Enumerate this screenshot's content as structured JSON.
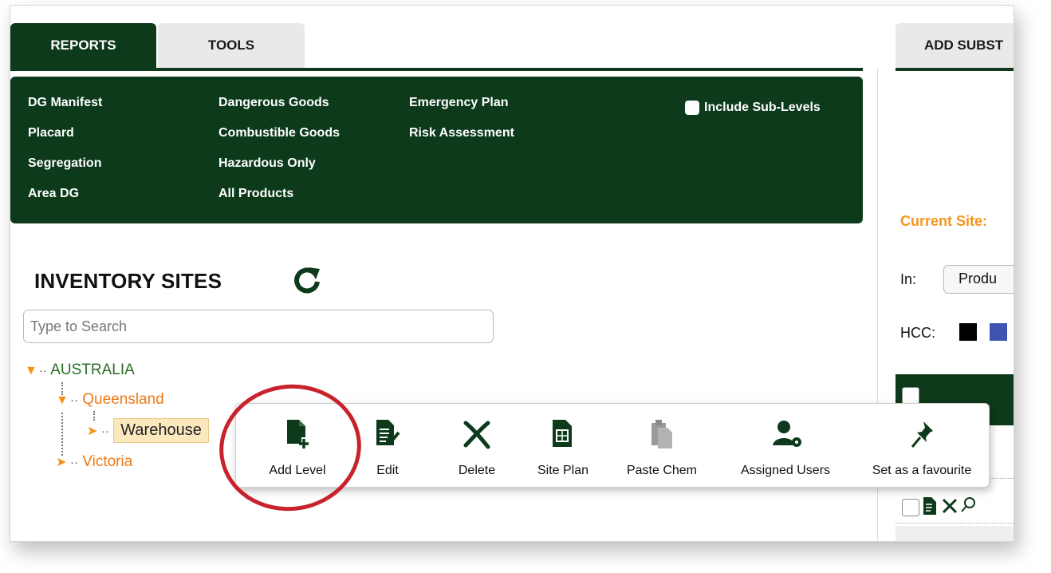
{
  "tabs": {
    "reports": "REPORTS",
    "tools": "TOOLS"
  },
  "reports": {
    "col1": [
      "DG Manifest",
      "Placard",
      "Segregation",
      "Area DG"
    ],
    "col2": [
      "Dangerous Goods",
      "Combustible Goods",
      "Hazardous Only",
      "All Products"
    ],
    "col3": [
      "Emergency Plan",
      "Risk Assessment"
    ],
    "include_sublevels_label": "Include Sub-Levels",
    "include_sublevels_checked": false
  },
  "inventory": {
    "title": "INVENTORY SITES",
    "search_placeholder": "Type to Search",
    "tree": {
      "root": "AUSTRALIA",
      "state1": "Queensland",
      "site": "Warehouse",
      "state2": "Victoria"
    }
  },
  "context_menu": {
    "items": [
      {
        "label": "Add Level",
        "icon": "add-level-icon"
      },
      {
        "label": "Edit",
        "icon": "edit-icon"
      },
      {
        "label": "Delete",
        "icon": "delete-icon"
      },
      {
        "label": "Site Plan",
        "icon": "site-plan-icon"
      },
      {
        "label": "Paste Chem",
        "icon": "paste-icon"
      },
      {
        "label": "Assigned Users",
        "icon": "user-settings-icon"
      },
      {
        "label": "Set as a favourite",
        "icon": "pin-icon"
      }
    ]
  },
  "right_panel": {
    "tab": "ADD SUBST",
    "current_site_label": "Current Site:",
    "in_label": "In:",
    "in_value": "Produ",
    "hcc_label": "HCC:"
  },
  "colors": {
    "dark_green": "#0c3a1a",
    "orange": "#ee7a16",
    "annotation_red": "#c8232c"
  }
}
